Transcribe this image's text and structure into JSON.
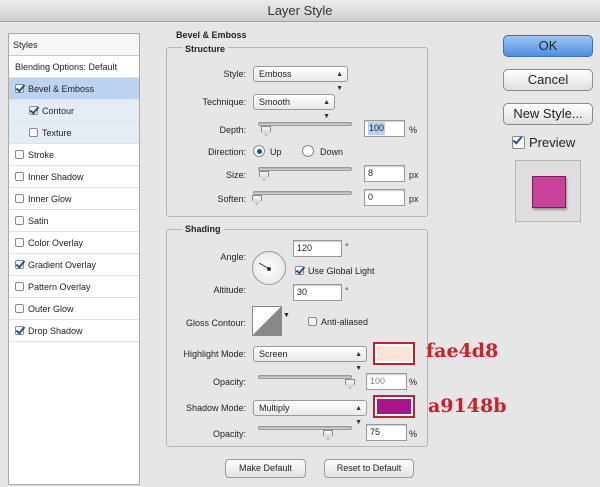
{
  "window": {
    "title": "Layer Style"
  },
  "styles_panel": {
    "header": "Styles",
    "items": [
      {
        "label": "Blending Options: Default",
        "checkbox": false,
        "checked": false
      },
      {
        "label": "Bevel & Emboss",
        "checkbox": true,
        "checked": true
      },
      {
        "label": "Contour",
        "checkbox": true,
        "checked": true
      },
      {
        "label": "Texture",
        "checkbox": true,
        "checked": false
      },
      {
        "label": "Stroke",
        "checkbox": true,
        "checked": false
      },
      {
        "label": "Inner Shadow",
        "checkbox": true,
        "checked": false
      },
      {
        "label": "Inner Glow",
        "checkbox": true,
        "checked": false
      },
      {
        "label": "Satin",
        "checkbox": true,
        "checked": false
      },
      {
        "label": "Color Overlay",
        "checkbox": true,
        "checked": false
      },
      {
        "label": "Gradient Overlay",
        "checkbox": true,
        "checked": true
      },
      {
        "label": "Pattern Overlay",
        "checkbox": true,
        "checked": false
      },
      {
        "label": "Outer Glow",
        "checkbox": true,
        "checked": false
      },
      {
        "label": "Drop Shadow",
        "checkbox": true,
        "checked": true
      }
    ]
  },
  "bevel": {
    "title": "Bevel & Emboss",
    "structure_title": "Structure",
    "style_label": "Style:",
    "style_value": "Emboss",
    "technique_label": "Technique:",
    "technique_value": "Smooth",
    "depth_label": "Depth:",
    "depth_value": "100",
    "depth_unit": "%",
    "direction_label": "Direction:",
    "dir_up": "Up",
    "dir_down": "Down",
    "direction_selected": "Up",
    "size_label": "Size:",
    "size_value": "8",
    "size_unit": "px",
    "soften_label": "Soften:",
    "soften_value": "0",
    "soften_unit": "px"
  },
  "shading": {
    "title": "Shading",
    "angle_label": "Angle:",
    "angle_value": "120",
    "angle_unit": "°",
    "global_light_label": "Use Global Light",
    "global_light_checked": true,
    "altitude_label": "Altitude:",
    "altitude_value": "30",
    "altitude_unit": "°",
    "gloss_label": "Gloss Contour:",
    "anti_aliased_label": "Anti-aliased",
    "anti_aliased_checked": false,
    "highlight_mode_label": "Highlight Mode:",
    "highlight_mode_value": "Screen",
    "highlight_color": "#fae4d8",
    "highlight_hex": "fae4d8",
    "highlight_opacity_label": "Opacity:",
    "highlight_opacity_value": "100",
    "opacity_unit": "%",
    "shadow_mode_label": "Shadow Mode:",
    "shadow_mode_value": "Multiply",
    "shadow_color": "#a9148b",
    "shadow_hex": "a9148b",
    "shadow_opacity_label": "Opacity:",
    "shadow_opacity_value": "75"
  },
  "footer": {
    "make_default": "Make Default",
    "reset_default": "Reset to Default"
  },
  "actions": {
    "ok": "OK",
    "cancel": "Cancel",
    "new_style": "New Style...",
    "preview": "Preview",
    "preview_checked": true
  },
  "preview_color": "#c8419a"
}
